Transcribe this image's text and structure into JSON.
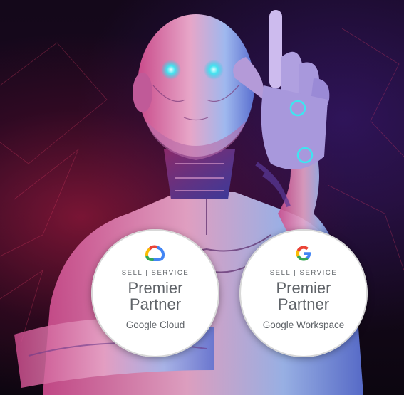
{
  "scene": {
    "description_icon": "humanoid-robot-illustration"
  },
  "badges": [
    {
      "sell_service": "SELL | SERVICE",
      "line1": "Premier",
      "line2": "Partner",
      "product": "Google Cloud",
      "icon": "google-cloud-logo-icon"
    },
    {
      "sell_service": "SELL | SERVICE",
      "line1": "Premier",
      "line2": "Partner",
      "product": "Google Workspace",
      "icon": "google-g-logo-icon"
    }
  ],
  "colors": {
    "google_blue": "#4285F4",
    "google_red": "#EA4335",
    "google_yellow": "#FBBC05",
    "google_green": "#34A853",
    "badge_text": "#5f6368"
  }
}
